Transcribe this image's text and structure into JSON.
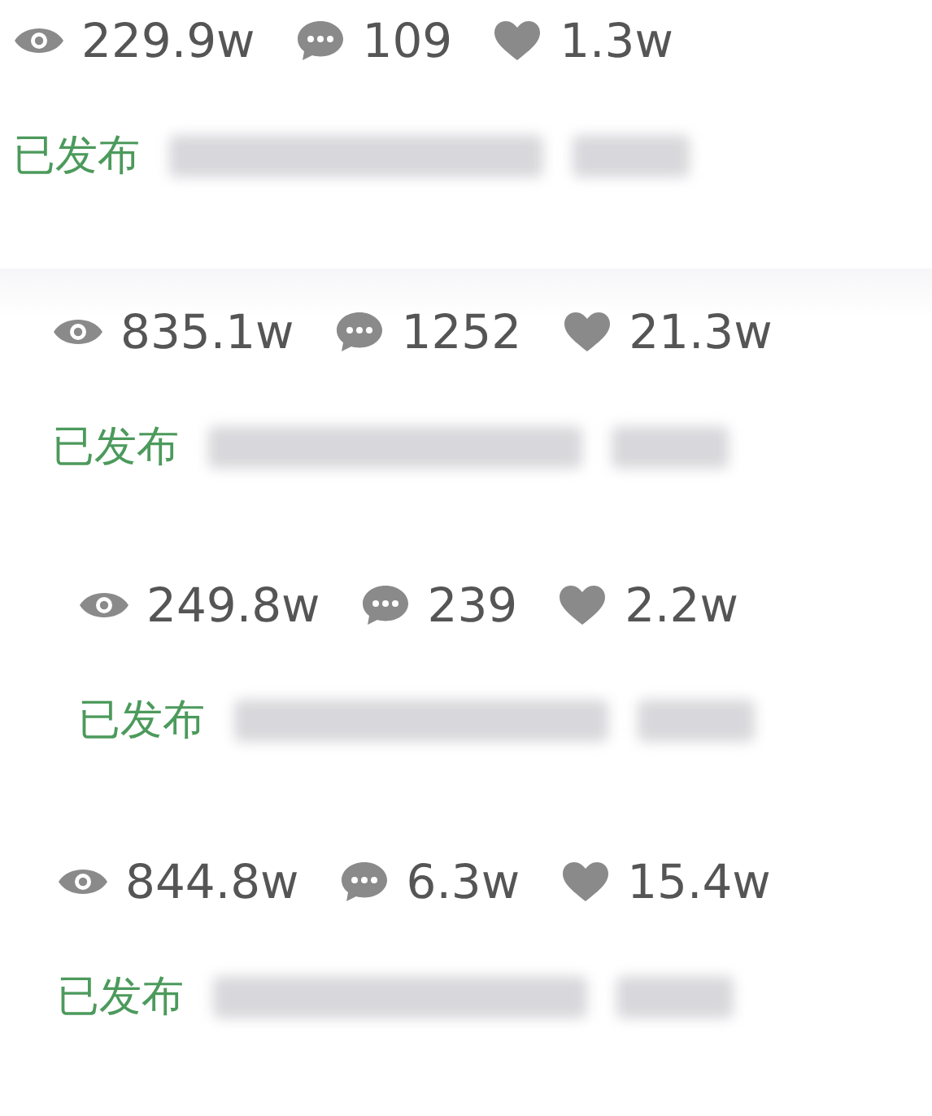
{
  "posts": [
    {
      "views": "229.9w",
      "comments": "109",
      "likes": "1.3w",
      "status": "已发布"
    },
    {
      "views": "835.1w",
      "comments": "1252",
      "likes": "21.3w",
      "status": "已发布"
    },
    {
      "views": "249.8w",
      "comments": "239",
      "likes": "2.2w",
      "status": "已发布"
    },
    {
      "views": "844.8w",
      "comments": "6.3w",
      "likes": "15.4w",
      "status": "已发布"
    }
  ]
}
